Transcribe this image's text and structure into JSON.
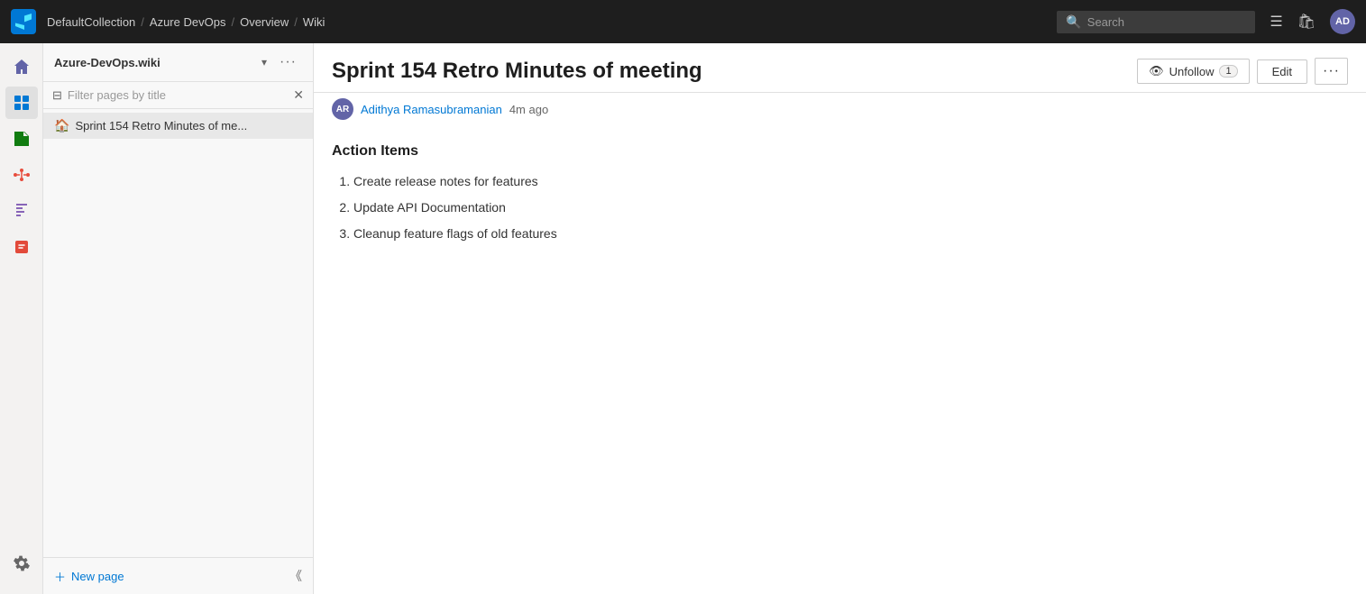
{
  "topbar": {
    "logo_title": "Azure DevOps",
    "breadcrumbs": [
      "DefaultCollection",
      "Azure DevOps",
      "Overview",
      "Wiki"
    ],
    "search_placeholder": "Search"
  },
  "activity_bar": {
    "items": [
      {
        "name": "home",
        "icon": "🏠"
      },
      {
        "name": "boards",
        "icon": "📋"
      },
      {
        "name": "repos",
        "icon": "📁"
      },
      {
        "name": "pipelines",
        "icon": "🔁"
      },
      {
        "name": "test-plans",
        "icon": "🧪"
      },
      {
        "name": "artifacts",
        "icon": "📦"
      }
    ],
    "settings_icon": "⚙"
  },
  "sidebar": {
    "wiki_title": "Azure-DevOps.wiki",
    "filter_placeholder": "Filter pages by title",
    "tree_items": [
      {
        "label": "Sprint 154 Retro Minutes of me...",
        "icon": "🏠"
      }
    ],
    "new_page_label": "New page",
    "collapse_label": "Collapse"
  },
  "page": {
    "title": "Sprint 154 Retro Minutes of meeting",
    "author_initials": "AR",
    "author_name": "Adithya Ramasubramanian",
    "time_ago": "4m ago",
    "unfollow_label": "Unfollow",
    "unfollow_count": "1",
    "edit_label": "Edit",
    "section_title": "Action Items",
    "action_items": [
      "Create release notes for features",
      "Update API Documentation",
      "Cleanup feature flags of old features"
    ]
  },
  "user": {
    "initials": "AD"
  }
}
